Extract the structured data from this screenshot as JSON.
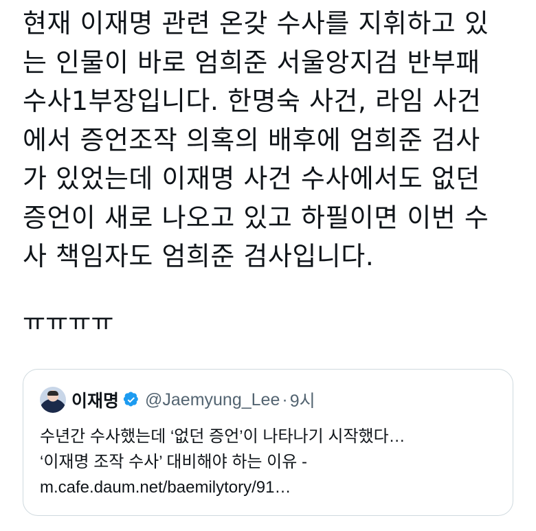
{
  "tweet": {
    "lines": [
      "현재 이재명 관련 온갖 수사를 지휘하고 있",
      "는 인물이 바로 엄희준 서울앙지검 반부패",
      "수사1부장입니다. 한명숙 사건, 라임 사건",
      "에서 증언조작 의혹의 배후에 엄희준 검사",
      "가 있었는데 이재명 사건 수사에서도 없던",
      "증언이 새로 나오고 있고 하필이면 이번 수",
      "사 책임자도 엄희준 검사입니다."
    ],
    "emote": "ㅠㅠㅠㅠ"
  },
  "quote": {
    "author_name": "이재명",
    "handle": "@Jaemyung_Lee",
    "separator": "·",
    "time": "9시",
    "avatar_icon": "user-avatar-photo",
    "verified_icon": "verified-badge-icon",
    "verified_color": "#1d9bf0",
    "text_lines": [
      "수년간 수사했는데 ‘없던 증언’이 나타나기 시작했다…",
      "‘이재명 조작 수사’ 대비해야 하는 이유 -",
      "m.cafe.daum.net/baemilytory/91…"
    ]
  }
}
